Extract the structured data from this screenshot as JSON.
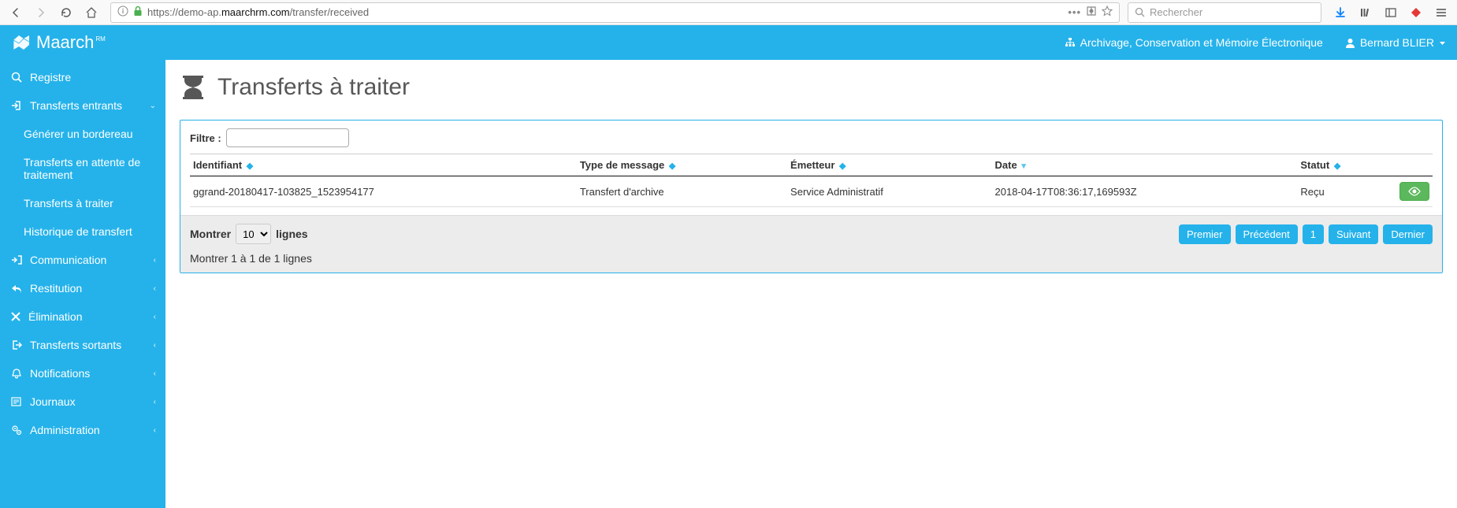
{
  "browser": {
    "url_prefix": "https://demo-ap.",
    "url_bold": "maarchrm.com",
    "url_suffix": "/transfer/received",
    "search_placeholder": "Rechercher"
  },
  "header": {
    "brand": "Maarch",
    "brand_sub": "RM",
    "title": "Archivage, Conservation et Mémoire Électronique",
    "user": "Bernard BLIER"
  },
  "sidebar": {
    "items": [
      {
        "label": "Registre",
        "icon": "search"
      },
      {
        "label": "Transferts entrants",
        "icon": "sign-in",
        "expanded": true,
        "children": [
          {
            "label": "Générer un bordereau"
          },
          {
            "label": "Transferts en attente de traitement"
          },
          {
            "label": "Transferts à traiter"
          },
          {
            "label": "Historique de transfert"
          }
        ]
      },
      {
        "label": "Communication",
        "icon": "share",
        "chev": true
      },
      {
        "label": "Restitution",
        "icon": "reply",
        "chev": true
      },
      {
        "label": "Élimination",
        "icon": "times",
        "chev": true
      },
      {
        "label": "Transferts sortants",
        "icon": "sign-out",
        "chev": true
      },
      {
        "label": "Notifications",
        "icon": "bell",
        "chev": true
      },
      {
        "label": "Journaux",
        "icon": "newspaper",
        "chev": true
      },
      {
        "label": "Administration",
        "icon": "cogs",
        "chev": true
      }
    ]
  },
  "page": {
    "title": "Transferts à traiter",
    "filter_label": "Filtre :",
    "columns": {
      "id": "Identifiant",
      "type": "Type de message",
      "emitter": "Émetteur",
      "date": "Date",
      "status": "Statut"
    },
    "rows": [
      {
        "id": "ggrand-20180417-103825_1523954177",
        "type": "Transfert d'archive",
        "emitter": "Service Administratif",
        "date": "2018-04-17T08:36:17,169593Z",
        "status": "Reçu"
      }
    ],
    "footer": {
      "show_before": "Montrer",
      "show_value": "10",
      "show_after": "lignes",
      "summary": "Montrer 1 à 1 de 1 lignes",
      "pager": {
        "first": "Premier",
        "prev": "Précédent",
        "page": "1",
        "next": "Suivant",
        "last": "Dernier"
      }
    }
  }
}
